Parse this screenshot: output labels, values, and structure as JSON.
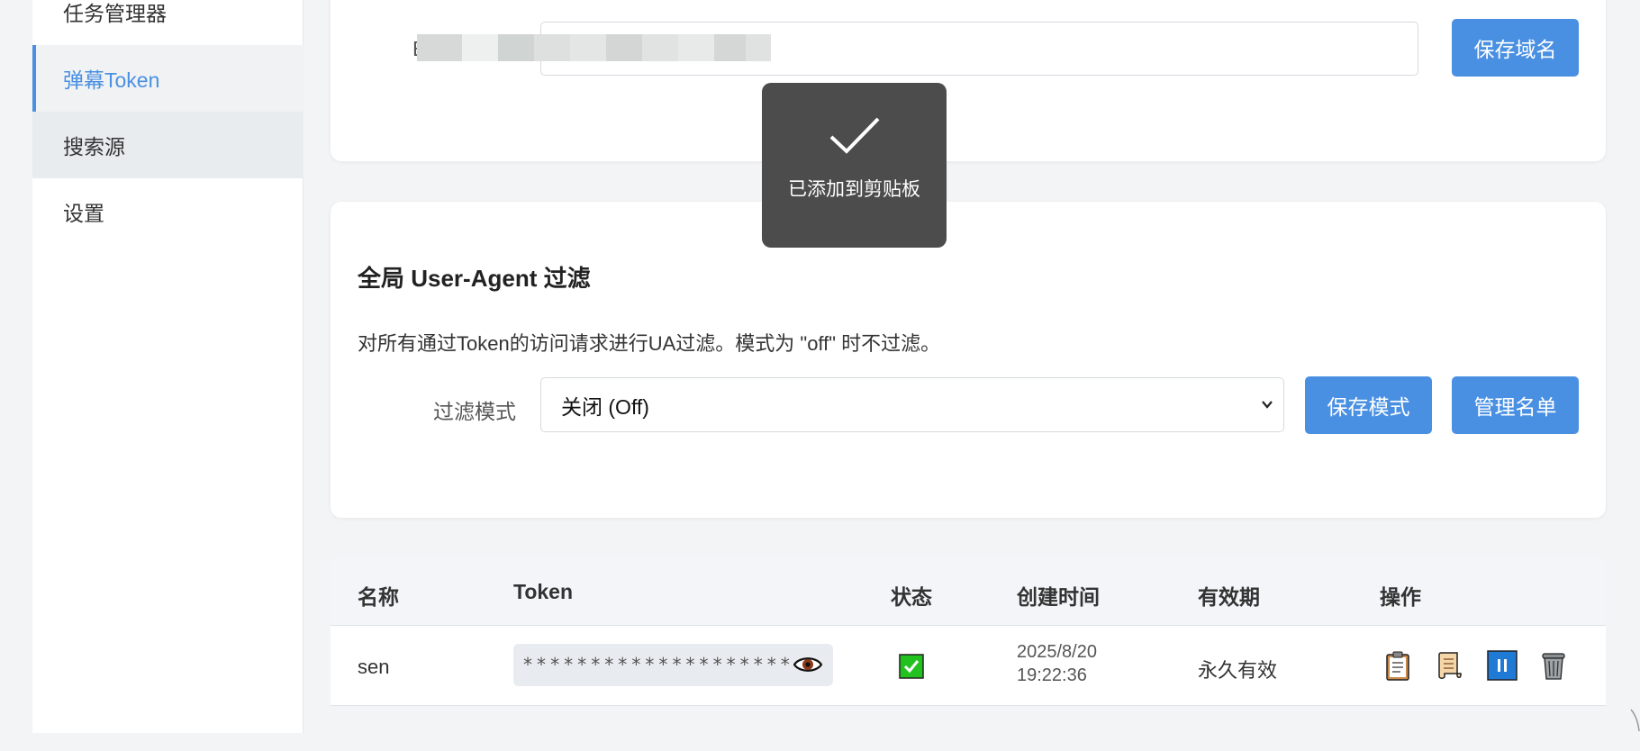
{
  "sidebar": {
    "items": [
      {
        "label": "任务管理器"
      },
      {
        "label": "弹幕Token"
      },
      {
        "label": "搜索源"
      },
      {
        "label": "设置"
      }
    ]
  },
  "domain_card": {
    "label_partial": "E",
    "save_button": "保存域名"
  },
  "toast": {
    "message": "已添加到剪贴板"
  },
  "ua_filter": {
    "title": "全局 User-Agent 过滤",
    "description": "对所有通过Token的访问请求进行UA过滤。模式为 \"off\" 时不过滤。",
    "mode_label": "过滤模式",
    "mode_selected": "关闭 (Off)",
    "save_mode_button": "保存模式",
    "manage_list_button": "管理名单"
  },
  "token_table": {
    "headers": [
      "名称",
      "Token",
      "状态",
      "创建时间",
      "有效期",
      "操作"
    ],
    "rows": [
      {
        "name": "sen",
        "token_masked": "********************",
        "status": "enabled",
        "created_date": "2025/8/20",
        "created_time": "19:22:36",
        "validity": "永久有效"
      }
    ],
    "action_icons": [
      "clipboard-icon",
      "scroll-icon",
      "pause-icon",
      "trash-icon"
    ]
  },
  "colors": {
    "accent": "#4a90e2",
    "toast_bg": "#4c4c4c",
    "status_green": "#22c21e"
  }
}
